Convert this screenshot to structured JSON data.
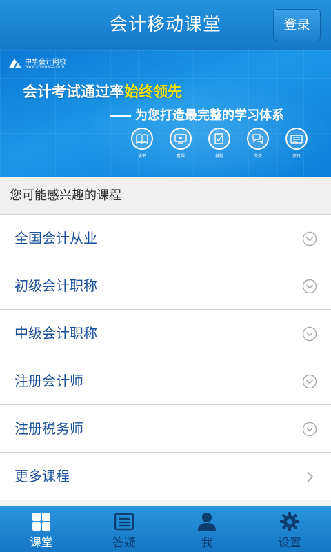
{
  "header": {
    "title": "会计移动课堂",
    "login_label": "登录"
  },
  "banner": {
    "logo_name": "中华会计网校",
    "logo_url": "www.chinaacc.com",
    "slogan_prefix": "会计考试通过率",
    "slogan_highlight": "始终领先",
    "sub_slogan": "为您打造最完整的学习体系",
    "features": [
      {
        "label": "读书",
        "icon": "book-icon"
      },
      {
        "label": "看课",
        "icon": "lecture-icon"
      },
      {
        "label": "做题",
        "icon": "exercise-icon"
      },
      {
        "label": "交流",
        "icon": "discussion-icon"
      },
      {
        "label": "资讯",
        "icon": "news-icon"
      }
    ],
    "colors": {
      "highlight": "#ffe600",
      "background": "#1489de"
    }
  },
  "section": {
    "title": "您可能感兴趣的课程"
  },
  "courses": [
    {
      "label": "全国会计从业",
      "icon": "chevron-down-circle-icon"
    },
    {
      "label": "初级会计职称",
      "icon": "chevron-down-circle-icon"
    },
    {
      "label": "中级会计职称",
      "icon": "chevron-down-circle-icon"
    },
    {
      "label": "注册会计师",
      "icon": "chevron-down-circle-icon"
    },
    {
      "label": "注册税务师",
      "icon": "chevron-down-circle-icon"
    },
    {
      "label": "更多课程",
      "icon": "chevron-right-icon"
    }
  ],
  "tabs": [
    {
      "label": "课堂",
      "icon": "grid-icon",
      "active": true
    },
    {
      "label": "答疑",
      "icon": "qa-list-icon",
      "active": false
    },
    {
      "label": "我",
      "icon": "user-icon",
      "active": false
    },
    {
      "label": "设置",
      "icon": "gear-icon",
      "active": false
    }
  ],
  "colors": {
    "primary": "#1a84d4",
    "list_text": "#1a4f9a",
    "tab_inactive_text": "#0b3d70"
  }
}
